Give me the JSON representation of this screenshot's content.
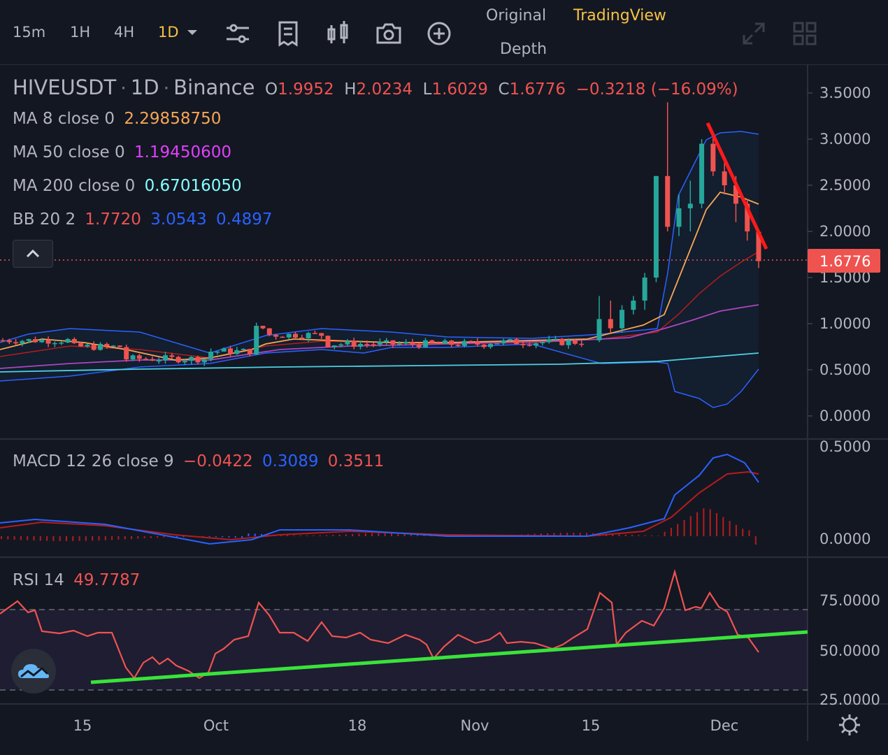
{
  "toolbar": {
    "timeframes": [
      "15m",
      "1H",
      "4H",
      "1D"
    ],
    "active_timeframe": "1D",
    "view_tabs": {
      "original": "Original",
      "tradingview": "TradingView",
      "depth": "Depth"
    }
  },
  "legend": {
    "symbol": "HIVEUSDT",
    "interval": "1D",
    "exchange": "Binance",
    "o_label": "O",
    "o": "1.9952",
    "h_label": "H",
    "h": "2.0234",
    "l_label": "L",
    "l": "1.6029",
    "c_label": "C",
    "c": "1.6776",
    "change": "−0.3218 (−16.09%)",
    "ma8_label": "MA 8 close 0",
    "ma8": "2.29858750",
    "ma50_label": "MA 50 close 0",
    "ma50": "1.19450600",
    "ma200_label": "MA 200 close 0",
    "ma200": "0.67016050",
    "bb_label": "BB 20 2",
    "bb_mid": "1.7720",
    "bb_up": "3.0543",
    "bb_low": "0.4897",
    "macd_label": "MACD 12 26 close 9",
    "macd_hist": "−0.0422",
    "macd": "0.3089",
    "macd_signal": "0.3511",
    "rsi_label": "RSI 14",
    "rsi": "49.7787"
  },
  "price_axis": [
    "3.5000",
    "3.0000",
    "2.5000",
    "2.0000",
    "1.5000",
    "1.0000",
    "0.5000",
    "0.0000"
  ],
  "current_price": "1.6776",
  "macd_axis": [
    "0.5000",
    "0.0000"
  ],
  "rsi_axis": [
    "75.0000",
    "50.0000",
    "25.0000"
  ],
  "time_axis": [
    "15",
    "Oct",
    "18",
    "Nov",
    "15",
    "Dec"
  ],
  "colors": {
    "up": "#26a69a",
    "down": "#ef5350",
    "accent": "#f6c343",
    "bg": "#131722"
  },
  "chart_data": {
    "type": "candlestick",
    "symbol": "HIVEUSDT",
    "price_ylim": [
      0,
      3.5
    ],
    "recent_candles": [
      {
        "o": 0.82,
        "h": 1.3,
        "l": 0.8,
        "c": 1.05
      },
      {
        "o": 1.05,
        "h": 1.25,
        "l": 0.9,
        "c": 0.95
      },
      {
        "o": 0.95,
        "h": 1.2,
        "l": 0.9,
        "c": 1.15
      },
      {
        "o": 1.15,
        "h": 1.3,
        "l": 1.1,
        "c": 1.25
      },
      {
        "o": 1.25,
        "h": 1.55,
        "l": 1.15,
        "c": 1.5
      },
      {
        "o": 1.5,
        "h": 2.6,
        "l": 1.45,
        "c": 2.6
      },
      {
        "o": 2.6,
        "h": 3.4,
        "l": 2.0,
        "c": 2.05
      },
      {
        "o": 2.05,
        "h": 2.4,
        "l": 1.95,
        "c": 2.25
      },
      {
        "o": 2.25,
        "h": 2.55,
        "l": 2.0,
        "c": 2.3
      },
      {
        "o": 2.3,
        "h": 3.0,
        "l": 2.25,
        "c": 2.95
      },
      {
        "o": 2.95,
        "h": 3.05,
        "l": 2.6,
        "c": 2.65
      },
      {
        "o": 2.65,
        "h": 2.75,
        "l": 2.4,
        "c": 2.5
      },
      {
        "o": 2.5,
        "h": 2.6,
        "l": 2.1,
        "c": 2.3
      },
      {
        "o": 2.3,
        "h": 2.35,
        "l": 1.9,
        "c": 2.0
      },
      {
        "o": 1.9952,
        "h": 2.0234,
        "l": 1.6029,
        "c": 1.6776
      }
    ],
    "indicators": {
      "ma8": 2.2986,
      "ma50": 1.1945,
      "ma200": 0.6702,
      "bb_mid": 1.772,
      "bb_upper": 3.0543,
      "bb_lower": 0.4897
    },
    "macd": {
      "hist": -0.0422,
      "macd": 0.3089,
      "signal": 0.3511,
      "ylim": [
        -0.05,
        0.5
      ]
    },
    "rsi": {
      "value": 49.7787,
      "bands": [
        70,
        30
      ]
    }
  }
}
